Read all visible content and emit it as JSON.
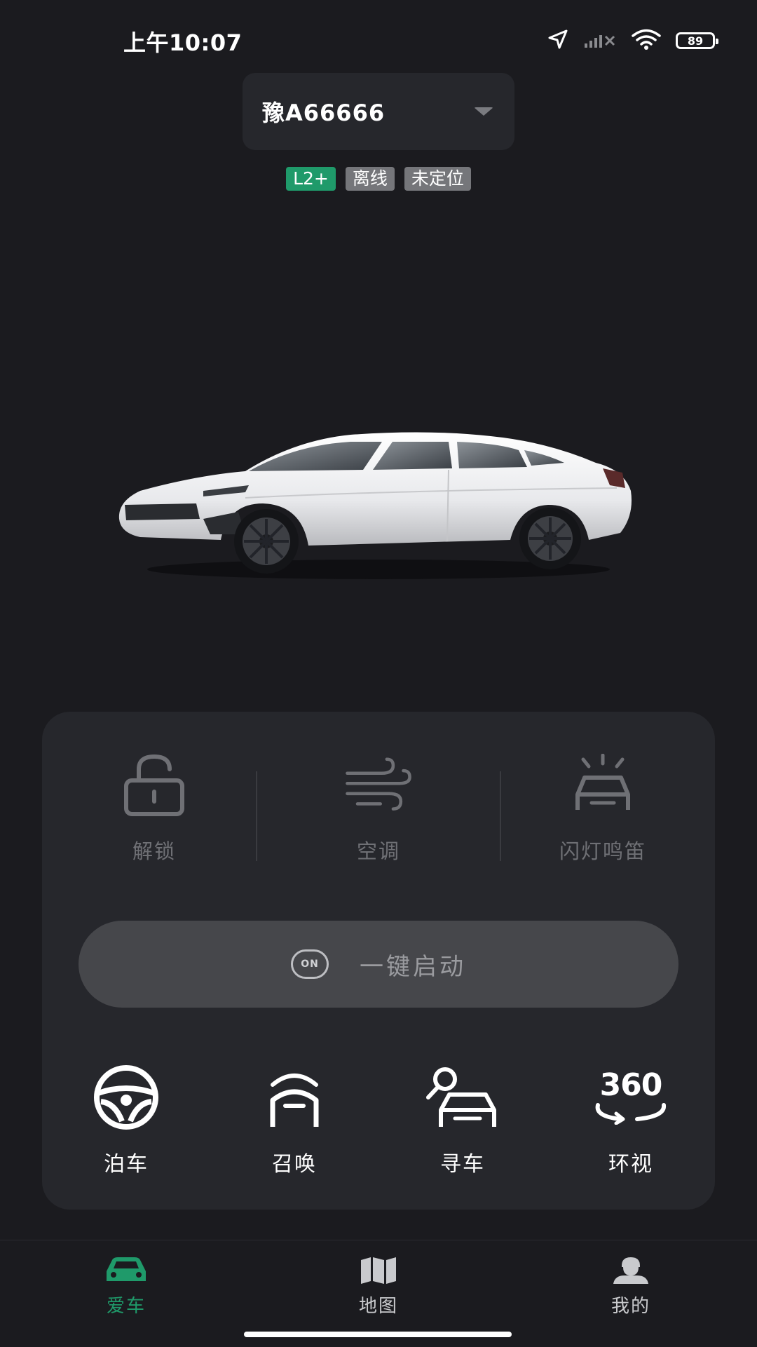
{
  "status_bar": {
    "time": "上午10:07",
    "battery": "89",
    "icons": [
      "location-arrow-icon",
      "signal-bars-icon",
      "wifi-icon",
      "battery-icon"
    ]
  },
  "vehicle": {
    "plate": "豫A66666",
    "badges": [
      {
        "label": "L2+",
        "color": "#1f9a6a"
      },
      {
        "label": "离线",
        "color": "#75767a"
      },
      {
        "label": "未定位",
        "color": "#75767a"
      }
    ]
  },
  "quick_controls": [
    {
      "label": "解锁",
      "icon": "unlock-icon"
    },
    {
      "label": "空调",
      "icon": "air-conditioning-icon"
    },
    {
      "label": "闪灯鸣笛",
      "icon": "flash-horn-icon"
    }
  ],
  "start": {
    "badge": "ON",
    "label": "一键启动"
  },
  "actions": [
    {
      "label": "泊车",
      "icon": "steering-wheel-icon"
    },
    {
      "label": "召唤",
      "icon": "summon-icon"
    },
    {
      "label": "寻车",
      "icon": "find-car-icon"
    },
    {
      "label": "环视",
      "icon": "surround-view-icon",
      "icon_text": "360"
    }
  ],
  "bottom_nav": [
    {
      "label": "爱车",
      "icon": "car-icon",
      "active": true
    },
    {
      "label": "地图",
      "icon": "map-icon",
      "active": false
    },
    {
      "label": "我的",
      "icon": "user-icon",
      "active": false
    }
  ],
  "colors": {
    "background": "#1b1b1f",
    "card": "#26272c",
    "accent": "#1f9a6a"
  }
}
